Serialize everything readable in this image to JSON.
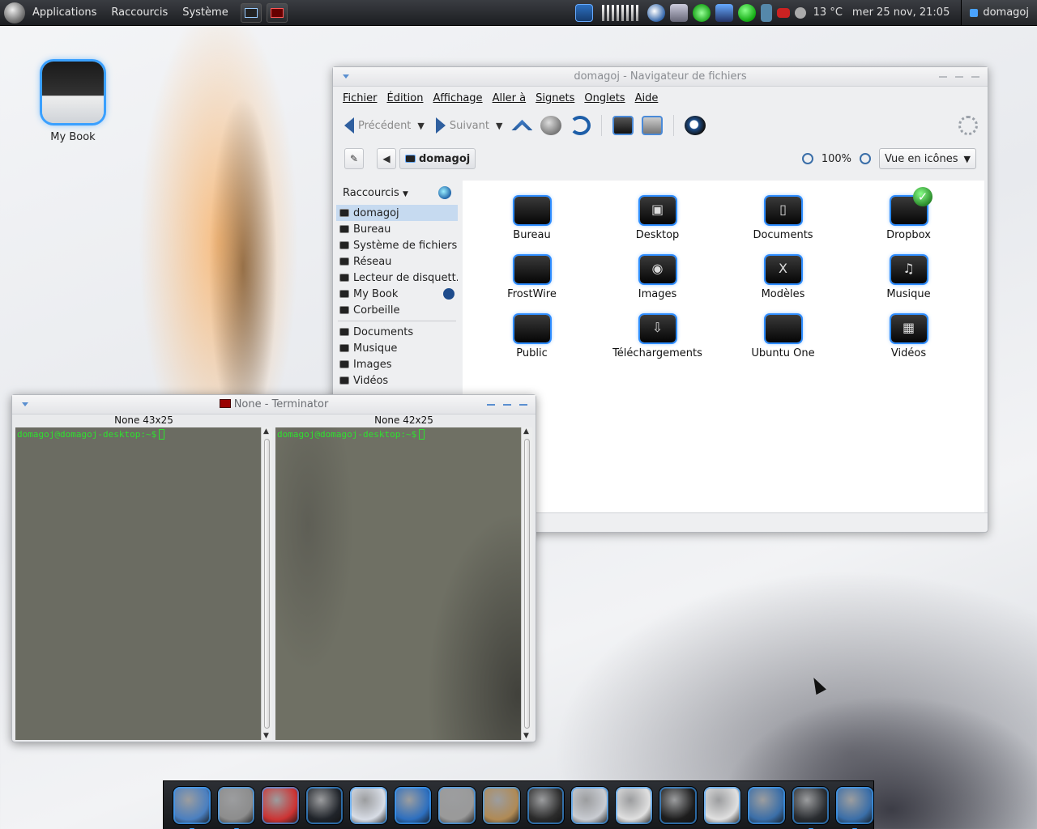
{
  "top_panel": {
    "menus": [
      "Applications",
      "Raccourcis",
      "Système"
    ],
    "weather": "13 °C",
    "clock": "mer 25 nov, 21:05",
    "user": "domagoj"
  },
  "desktop": {
    "icons": [
      {
        "label": "My Book",
        "icon": "drive-icon"
      }
    ]
  },
  "file_manager": {
    "title": "domagoj - Navigateur de fichiers",
    "menu": [
      "Fichier",
      "Édition",
      "Affichage",
      "Aller à",
      "Signets",
      "Onglets",
      "Aide"
    ],
    "toolbar": {
      "back": "Précédent",
      "forward": "Suivant"
    },
    "location": {
      "path_label": "domagoj",
      "zoom": "100%",
      "view_mode": "Vue en icônes"
    },
    "sidebar": {
      "header": "Raccourcis",
      "places": [
        {
          "label": "domagoj",
          "selected": true
        },
        {
          "label": "Bureau"
        },
        {
          "label": "Système de fichiers"
        },
        {
          "label": "Réseau"
        },
        {
          "label": "Lecteur de disquett..."
        },
        {
          "label": "My Book",
          "eject": true
        },
        {
          "label": "Corbeille"
        }
      ],
      "bookmarks": [
        {
          "label": "Documents"
        },
        {
          "label": "Musique"
        },
        {
          "label": "Images"
        },
        {
          "label": "Vidéos"
        }
      ]
    },
    "files": [
      {
        "label": "Bureau",
        "glyph": ""
      },
      {
        "label": "Desktop",
        "glyph": "▣"
      },
      {
        "label": "Documents",
        "glyph": "▯"
      },
      {
        "label": "Dropbox",
        "glyph": ""
      },
      {
        "label": "FrostWire",
        "glyph": ""
      },
      {
        "label": "Images",
        "glyph": "◉"
      },
      {
        "label": "Modèles",
        "glyph": "X"
      },
      {
        "label": "Musique",
        "glyph": "♫"
      },
      {
        "label": "Public",
        "glyph": ""
      },
      {
        "label": "Téléchargements",
        "glyph": "⇩"
      },
      {
        "label": "Ubuntu One",
        "glyph": ""
      },
      {
        "label": "Vidéos",
        "glyph": "▦"
      }
    ]
  },
  "terminator": {
    "title": "None - Terminator",
    "panes": [
      {
        "header": "None 43x25",
        "prompt": "domagoj@domagoj-desktop:~$"
      },
      {
        "header": "None 42x25",
        "prompt": "domagoj@domagoj-desktop:~$"
      }
    ]
  },
  "dock": {
    "items": [
      {
        "icon": "settings-icon",
        "color": "#4a7fc0"
      },
      {
        "icon": "globe-icon",
        "color": "#8d8d8d"
      },
      {
        "icon": "pokeball-icon",
        "color": "#cc3333"
      },
      {
        "icon": "orb-icon",
        "color": "#20242a"
      },
      {
        "icon": "calendar-icon",
        "color": "#d8dde6"
      },
      {
        "icon": "writer-icon",
        "color": "#2d6fbf"
      },
      {
        "icon": "speaker-icon",
        "color": "#9a9a9a"
      },
      {
        "icon": "gimp-icon",
        "color": "#b08a55"
      },
      {
        "icon": "inkscape-icon",
        "color": "#2b2b2b"
      },
      {
        "icon": "scanner-icon",
        "color": "#c9ccd2"
      },
      {
        "icon": "wolf-icon",
        "color": "#e0e0e0"
      },
      {
        "icon": "disc-icon",
        "color": "#1d1d1d"
      },
      {
        "icon": "vlc-cone-icon",
        "color": "#e0e0e0"
      },
      {
        "icon": "refresh-icon",
        "color": "#3a6ea8"
      },
      {
        "icon": "terminal-icon",
        "color": "#2a2d31"
      },
      {
        "icon": "home-icon",
        "color": "#3a6ea8"
      }
    ]
  }
}
